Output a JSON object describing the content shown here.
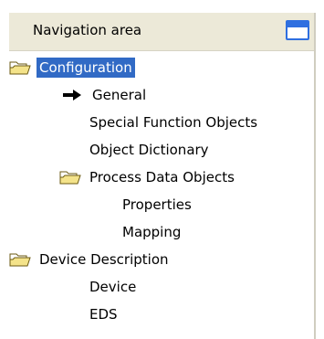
{
  "header": {
    "title": "Navigation area",
    "restore_icon": "window-restore-icon"
  },
  "tree": [
    {
      "label": "Configuration",
      "icon": "folder-open-icon",
      "selected": true
    },
    {
      "label": "General",
      "icon": "arrow-right-icon"
    },
    {
      "label": "Special Function Objects"
    },
    {
      "label": "Object Dictionary"
    },
    {
      "label": "Process Data Objects",
      "icon": "folder-open-icon"
    },
    {
      "label": "Properties"
    },
    {
      "label": "Mapping"
    },
    {
      "label": "Device Description",
      "icon": "folder-open-icon"
    },
    {
      "label": "Device"
    },
    {
      "label": "EDS"
    }
  ],
  "colors": {
    "selection": "#316ac5",
    "folder": "#e8d478",
    "header_bg": "#ece9d8"
  }
}
